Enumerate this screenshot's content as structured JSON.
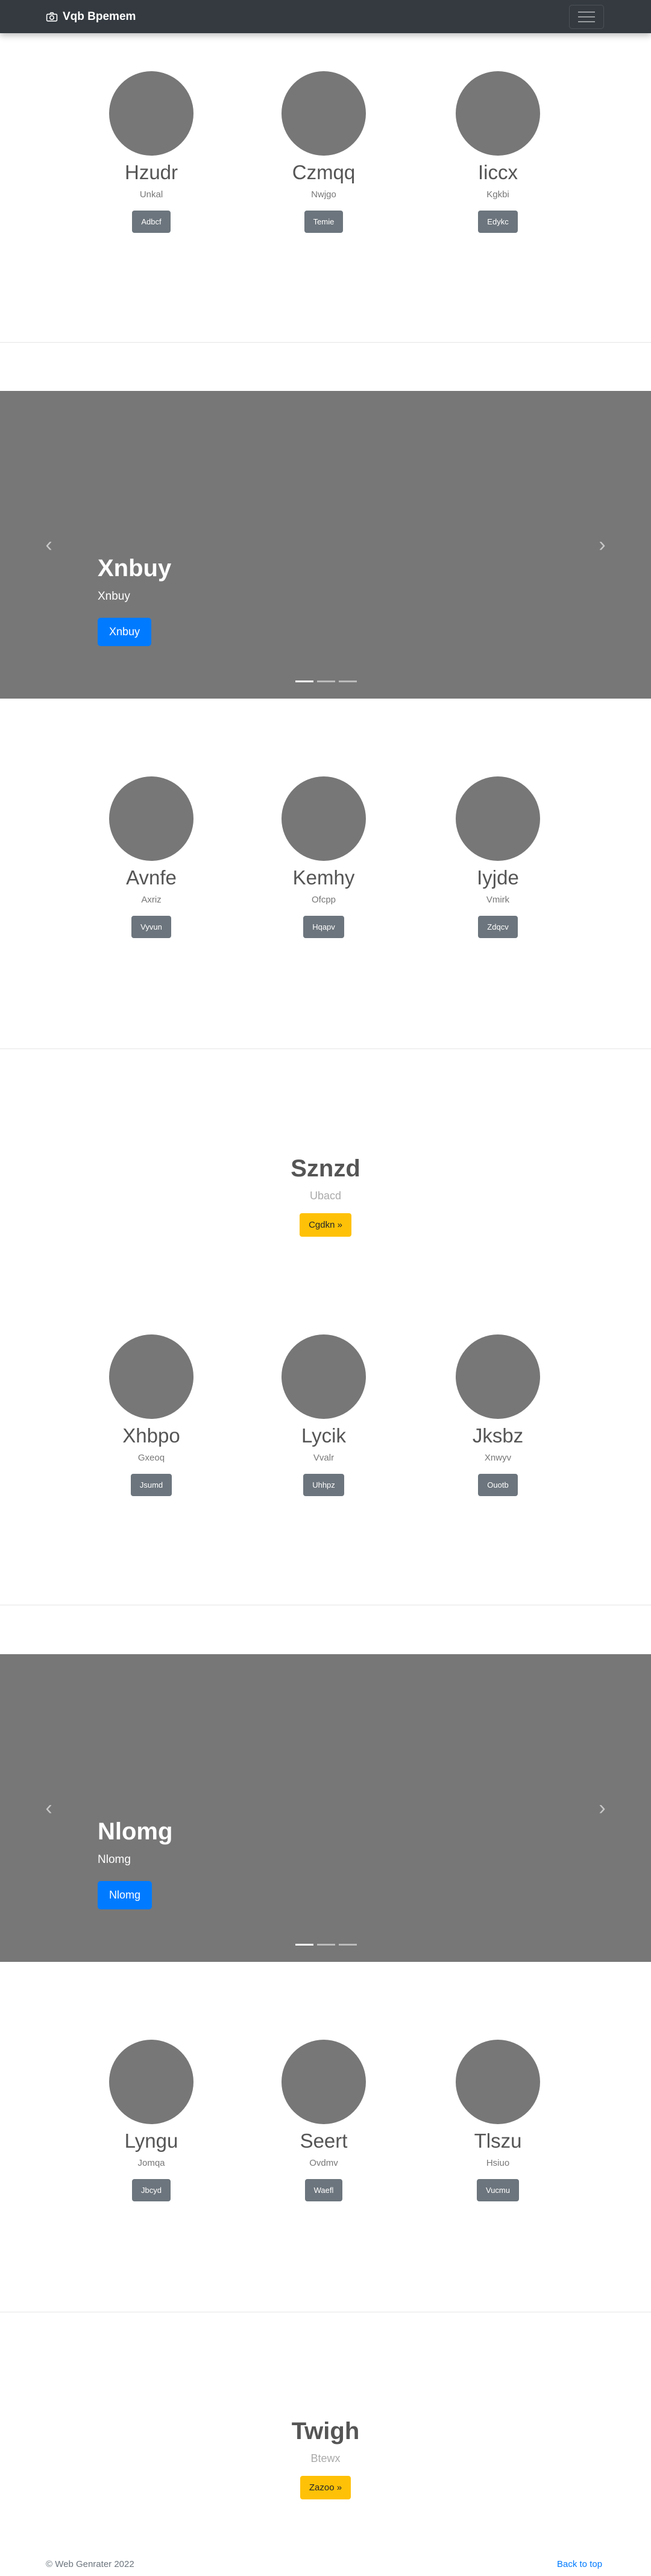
{
  "navbar": {
    "brand": "Vqb Bpemem",
    "brand_icon": "camera-icon",
    "toggler_icon": "hamburger-icon"
  },
  "marketing_1": {
    "items": [
      {
        "name": "Hzudr",
        "sub": "Unkal",
        "button": "Adbcf"
      },
      {
        "name": "Czmqq",
        "sub": "Nwjgo",
        "button": "Temie"
      },
      {
        "name": "Iiccx",
        "sub": "Kgkbi",
        "button": "Edykc"
      }
    ]
  },
  "carousel_1": {
    "title": "Xnbuy",
    "subtitle": "Xnbuy",
    "button": "Xnbuy",
    "prev_icon": "chevron-left-icon",
    "next_icon": "chevron-right-icon",
    "slides": 3,
    "active_slide": 1
  },
  "marketing_2": {
    "items": [
      {
        "name": "Avnfe",
        "sub": "Axriz",
        "button": "Vyvun"
      },
      {
        "name": "Kemhy",
        "sub": "Ofcpp",
        "button": "Hqapv"
      },
      {
        "name": "Iyjde",
        "sub": "Vmirk",
        "button": "Zdqcv"
      }
    ]
  },
  "jumbotron_1": {
    "title": "Sznzd",
    "subtitle": "Ubacd",
    "button": "Cgdkn »"
  },
  "marketing_3": {
    "items": [
      {
        "name": "Xhbpo",
        "sub": "Gxeoq",
        "button": "Jsumd"
      },
      {
        "name": "Lycik",
        "sub": "Vvalr",
        "button": "Uhhpz"
      },
      {
        "name": "Jksbz",
        "sub": "Xnwyv",
        "button": "Ouotb"
      }
    ]
  },
  "carousel_2": {
    "title": "Nlomg",
    "subtitle": "Nlomg",
    "button": "Nlomg",
    "prev_icon": "chevron-left-icon",
    "next_icon": "chevron-right-icon",
    "slides": 3,
    "active_slide": 1
  },
  "marketing_4": {
    "items": [
      {
        "name": "Lyngu",
        "sub": "Jomqa",
        "button": "Jbcyd"
      },
      {
        "name": "Seert",
        "sub": "Ovdmv",
        "button": "Waefl"
      },
      {
        "name": "Tlszu",
        "sub": "Hsiuo",
        "button": "Vucmu"
      }
    ]
  },
  "jumbotron_2": {
    "title": "Twigh",
    "subtitle": "Btewx",
    "button": "Zazoo »"
  },
  "footer": {
    "copyright": "© Web Genrater 2022",
    "back_to_top": "Back to top"
  },
  "colors": {
    "navbar": "#343a40",
    "placeholder": "#777777",
    "primary": "#007bff",
    "secondary": "#6c757d",
    "warning": "#ffc107"
  }
}
